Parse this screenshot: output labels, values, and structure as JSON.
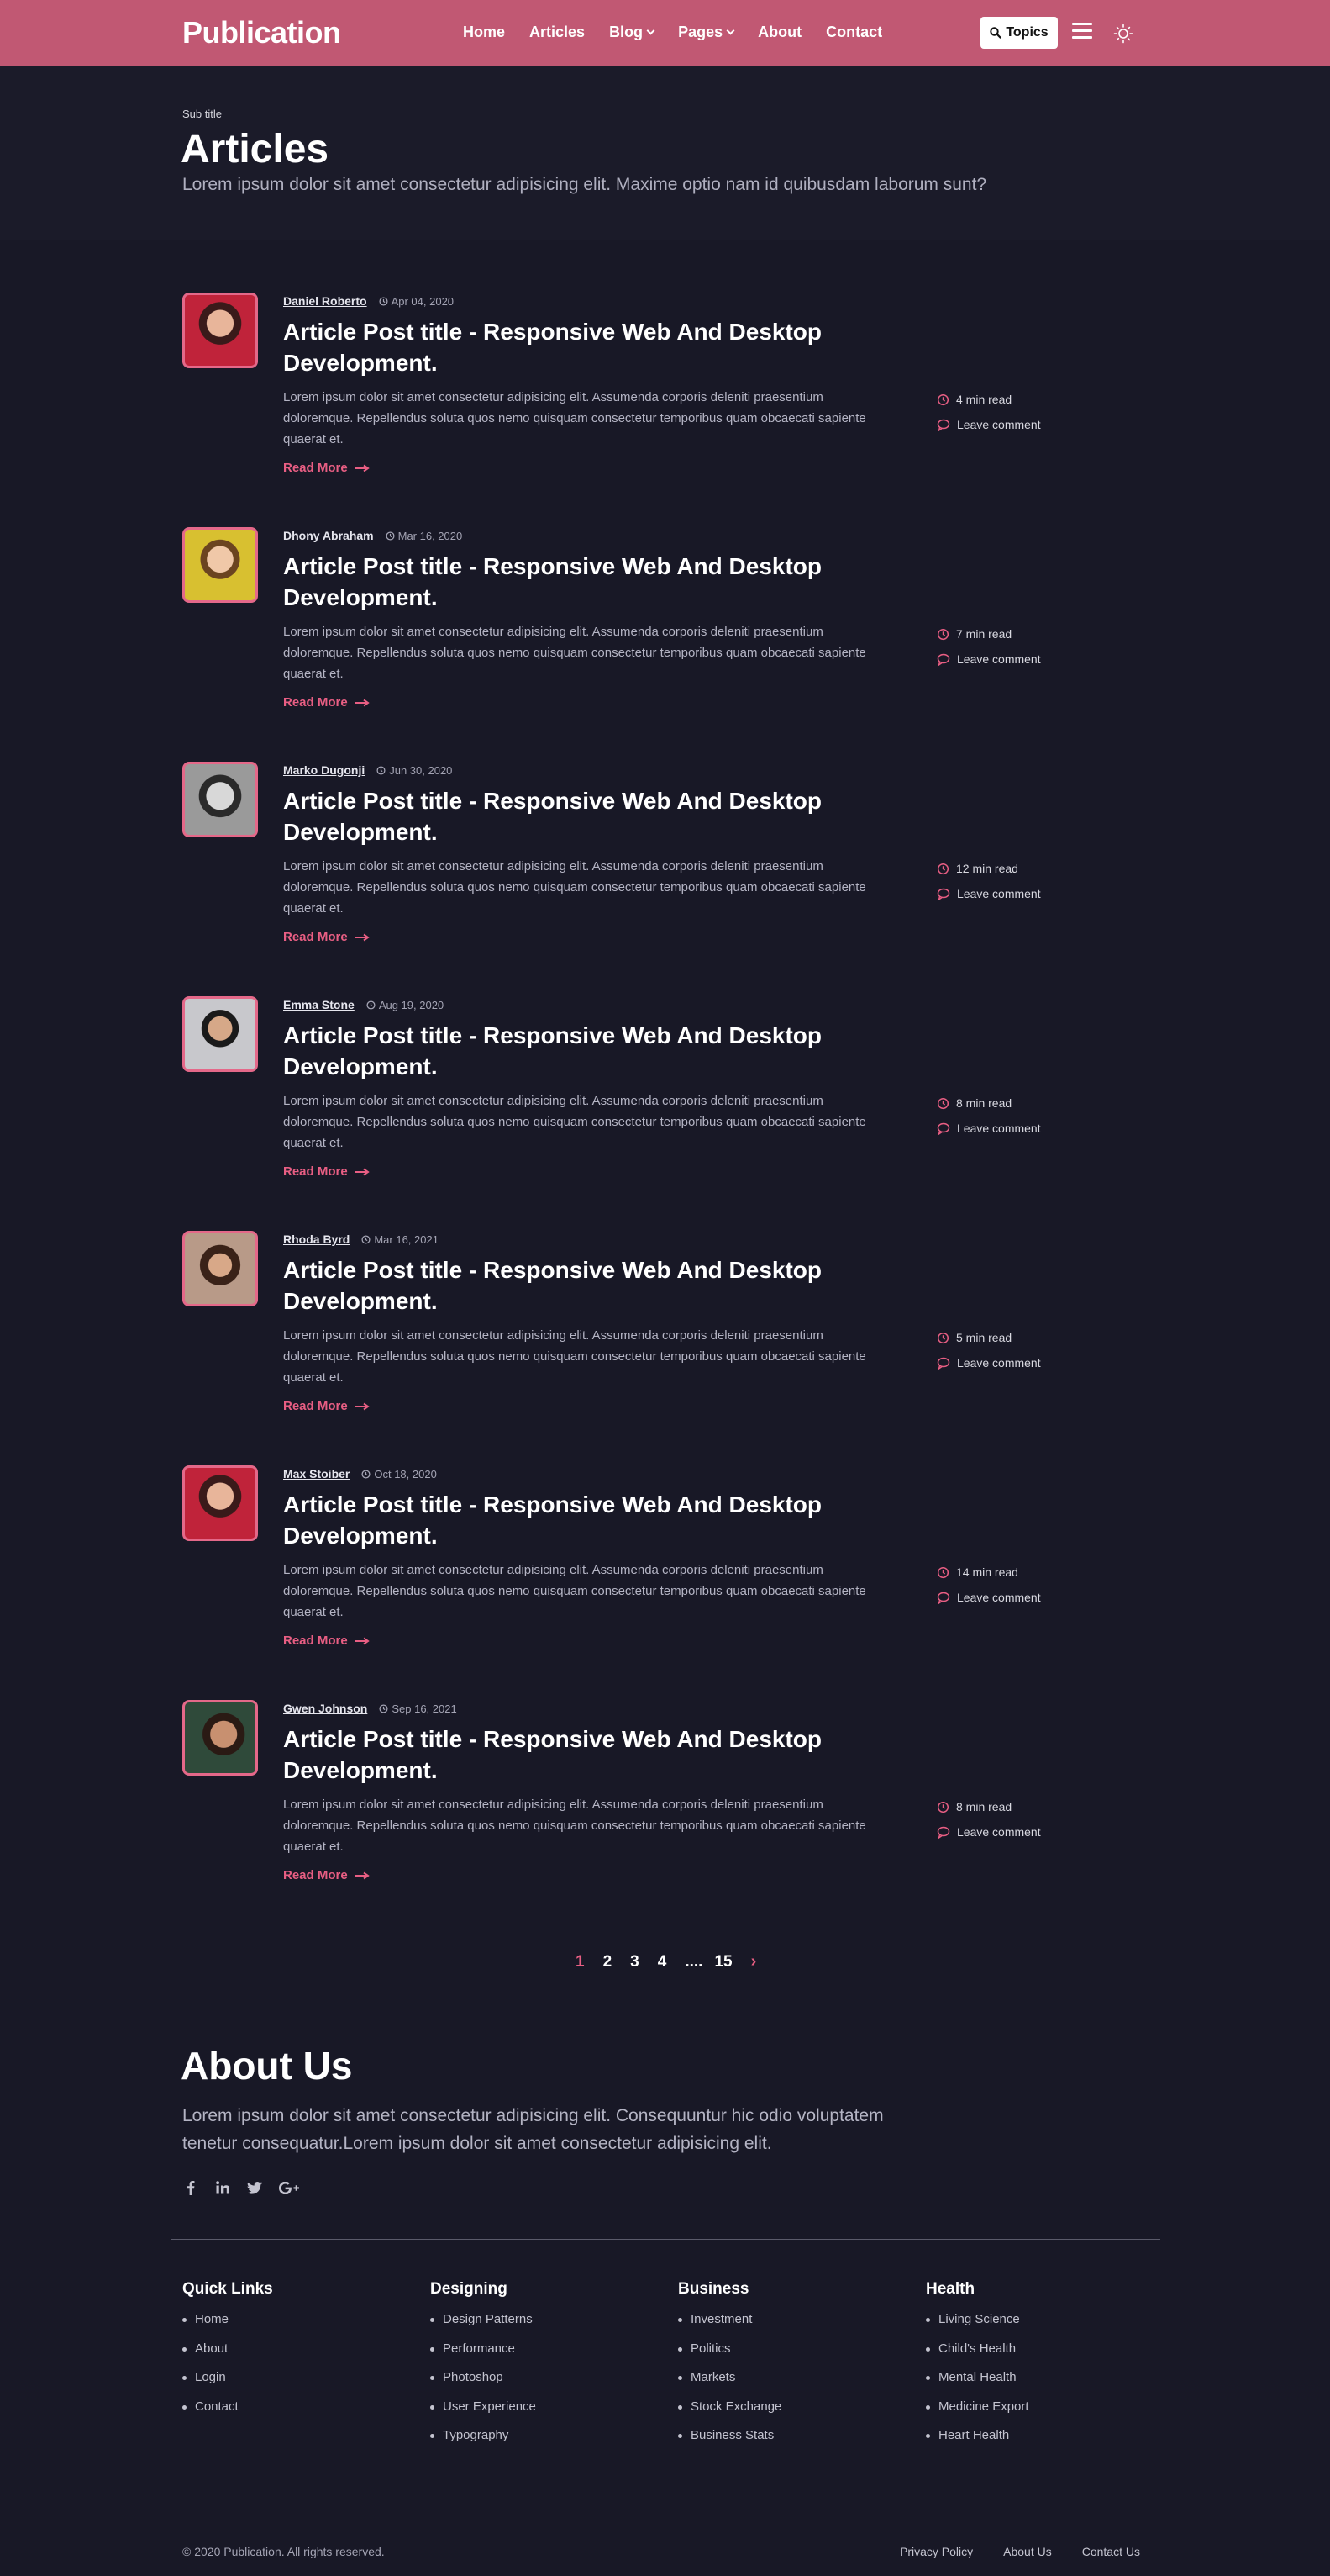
{
  "header": {
    "logo": "Publication",
    "nav": [
      {
        "label": "Home"
      },
      {
        "label": "Articles"
      },
      {
        "label": "Blog"
      },
      {
        "label": "Pages"
      },
      {
        "label": "About"
      },
      {
        "label": "Contact"
      }
    ],
    "topics_label": "Topics",
    "accent": "#c15873"
  },
  "hero": {
    "subtitle": "Sub title",
    "title": "Articles",
    "lead": "Lorem ipsum dolor sit amet consectetur adipisicing elit. Maxime optio nam id quibusdam laborum sunt?"
  },
  "articles": [
    {
      "author": "Daniel Roberto",
      "date": "Apr 04, 2020",
      "title": "Article Post title - Responsive Web And Desktop Development.",
      "excerpt": "Lorem ipsum dolor sit amet consectetur adipisicing elit. Assumenda corporis deleniti praesentium doloremque. Repellendus soluta quos nemo quisquam consectetur temporibus quam obcaecati sapiente quaerat et.",
      "read_more": "Read More",
      "read_time": "4 min read",
      "comment": "Leave comment"
    },
    {
      "author": "Dhony Abraham",
      "date": "Mar 16, 2020",
      "title": "Article Post title - Responsive Web And Desktop Development.",
      "excerpt": "Lorem ipsum dolor sit amet consectetur adipisicing elit. Assumenda corporis deleniti praesentium doloremque. Repellendus soluta quos nemo quisquam consectetur temporibus quam obcaecati sapiente quaerat et.",
      "read_more": "Read More",
      "read_time": "7 min read",
      "comment": "Leave comment"
    },
    {
      "author": "Marko Dugonji",
      "date": "Jun 30, 2020",
      "title": "Article Post title - Responsive Web And Desktop Development.",
      "excerpt": "Lorem ipsum dolor sit amet consectetur adipisicing elit. Assumenda corporis deleniti praesentium doloremque. Repellendus soluta quos nemo quisquam consectetur temporibus quam obcaecati sapiente quaerat et.",
      "read_more": "Read More",
      "read_time": "12 min read",
      "comment": "Leave comment"
    },
    {
      "author": "Emma Stone",
      "date": "Aug 19, 2020",
      "title": "Article Post title - Responsive Web And Desktop Development.",
      "excerpt": "Lorem ipsum dolor sit amet consectetur adipisicing elit. Assumenda corporis deleniti praesentium doloremque. Repellendus soluta quos nemo quisquam consectetur temporibus quam obcaecati sapiente quaerat et.",
      "read_more": "Read More",
      "read_time": "8 min read",
      "comment": "Leave comment"
    },
    {
      "author": "Rhoda Byrd",
      "date": "Mar 16, 2021",
      "title": "Article Post title - Responsive Web And Desktop Development.",
      "excerpt": "Lorem ipsum dolor sit amet consectetur adipisicing elit. Assumenda corporis deleniti praesentium doloremque. Repellendus soluta quos nemo quisquam consectetur temporibus quam obcaecati sapiente quaerat et.",
      "read_more": "Read More",
      "read_time": "5 min read",
      "comment": "Leave comment"
    },
    {
      "author": "Max Stoiber",
      "date": "Oct 18, 2020",
      "title": "Article Post title - Responsive Web And Desktop Development.",
      "excerpt": "Lorem ipsum dolor sit amet consectetur adipisicing elit. Assumenda corporis deleniti praesentium doloremque. Repellendus soluta quos nemo quisquam consectetur temporibus quam obcaecati sapiente quaerat et.",
      "read_more": "Read More",
      "read_time": "14 min read",
      "comment": "Leave comment"
    },
    {
      "author": "Gwen Johnson",
      "date": "Sep 16, 2021",
      "title": "Article Post title - Responsive Web And Desktop Development.",
      "excerpt": "Lorem ipsum dolor sit amet consectetur adipisicing elit. Assumenda corporis deleniti praesentium doloremque. Repellendus soluta quos nemo quisquam consectetur temporibus quam obcaecati sapiente quaerat et.",
      "read_more": "Read More",
      "read_time": "8 min read",
      "comment": "Leave comment"
    }
  ],
  "pagination": {
    "pages": [
      "1",
      "2",
      "3",
      "4"
    ],
    "dots": "....",
    "last": "15",
    "next": "›",
    "current": "1"
  },
  "about": {
    "title": "About Us",
    "text": "Lorem ipsum dolor sit amet consectetur adipisicing elit. Consequuntur hic odio voluptatem tenetur consequatur.Lorem ipsum dolor sit amet consectetur adipisicing elit.",
    "socials": [
      "facebook-icon",
      "linkedin-icon",
      "twitter-icon",
      "google-plus-icon"
    ]
  },
  "footer": {
    "columns": [
      {
        "title": "Quick Links",
        "links": [
          "Home",
          "About",
          "Login",
          "Contact"
        ]
      },
      {
        "title": "Designing",
        "links": [
          "Design Patterns",
          "Performance",
          "Photoshop",
          "User Experience",
          "Typography"
        ]
      },
      {
        "title": "Business",
        "links": [
          "Investment",
          "Politics",
          "Markets",
          "Stock Exchange",
          "Business Stats"
        ]
      },
      {
        "title": "Health",
        "links": [
          "Living Science",
          "Child's Health",
          "Mental Health",
          "Medicine Export",
          "Heart Health"
        ]
      }
    ],
    "copyright": "© 2020 Publication. All rights reserved.",
    "bottom_links": [
      "Privacy Policy",
      "About Us",
      "Contact Us"
    ]
  }
}
